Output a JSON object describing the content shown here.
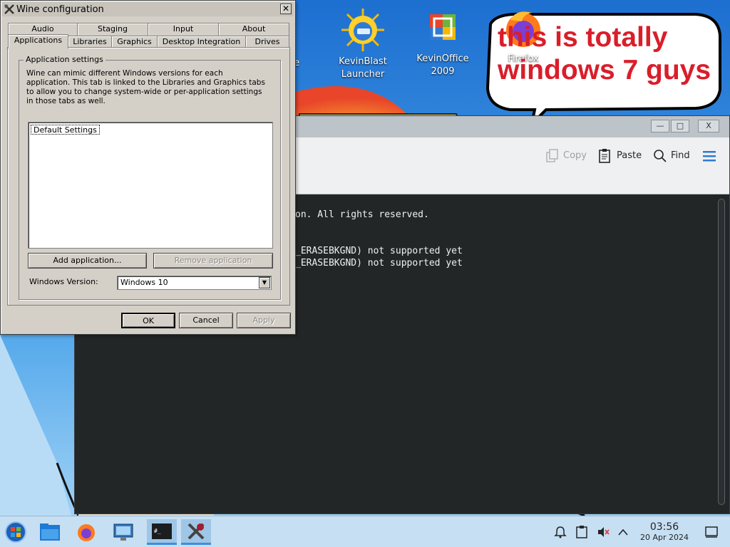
{
  "desktop": {
    "icons": [
      {
        "label": "ease",
        "icon": "release-icon"
      },
      {
        "label": "KevinBlast Launcher",
        "icon": "kevinblast-icon"
      },
      {
        "label": "KevinOffice 2009",
        "icon": "kevinoffice-icon"
      },
      {
        "label": "Firefox",
        "icon": "firefox-icon"
      }
    ],
    "bubble_text": "this is totally windows 7 guys",
    "bubble_color": "#d91e2a"
  },
  "konsole": {
    "toolbar": {
      "copy_label": "Copy",
      "paste_label": "Paste",
      "find_label": "Find",
      "menu_icon": "hamburger-icon"
    },
    "terminal_lines": [
      "on. All rights reserved.",
      "",
      "",
      "_ERASEBKGND) not supported yet",
      "_ERASEBKGND) not supported yet"
    ],
    "window_buttons": {
      "minimize": "—",
      "maximize": "□",
      "close": "X"
    }
  },
  "winecfg": {
    "title": "Wine configuration",
    "tabs_top": [
      "Audio",
      "Staging",
      "Input",
      "About"
    ],
    "tabs_bottom": [
      "Applications",
      "Libraries",
      "Graphics",
      "Desktop Integration",
      "Drives"
    ],
    "active_tab": "Applications",
    "group_label": "Application settings",
    "description": "Wine can mimic different Windows versions for each application. This tab is linked to the Libraries and Graphics tabs to allow you to change system-wide or per-application settings in those tabs as well.",
    "list_items": [
      "Default Settings"
    ],
    "add_button": "Add application...",
    "remove_button": "Remove application",
    "version_label": "Windows Version:",
    "version_value": "Windows 10",
    "ok_label": "OK",
    "cancel_label": "Cancel",
    "apply_label": "Apply"
  },
  "taskbar": {
    "items": [
      "start-orb-icon",
      "file-manager-icon",
      "firefox-icon",
      "system-settings-icon",
      "konsole-icon",
      "wine-config-icon"
    ],
    "clock_time": "03:56",
    "clock_date": "20 Apr 2024",
    "tray_icons": [
      "notifications-icon",
      "clipboard-icon",
      "volume-muted-icon",
      "tray-expand-icon",
      "show-desktop-icon"
    ],
    "accent": "#3d8ee0"
  }
}
